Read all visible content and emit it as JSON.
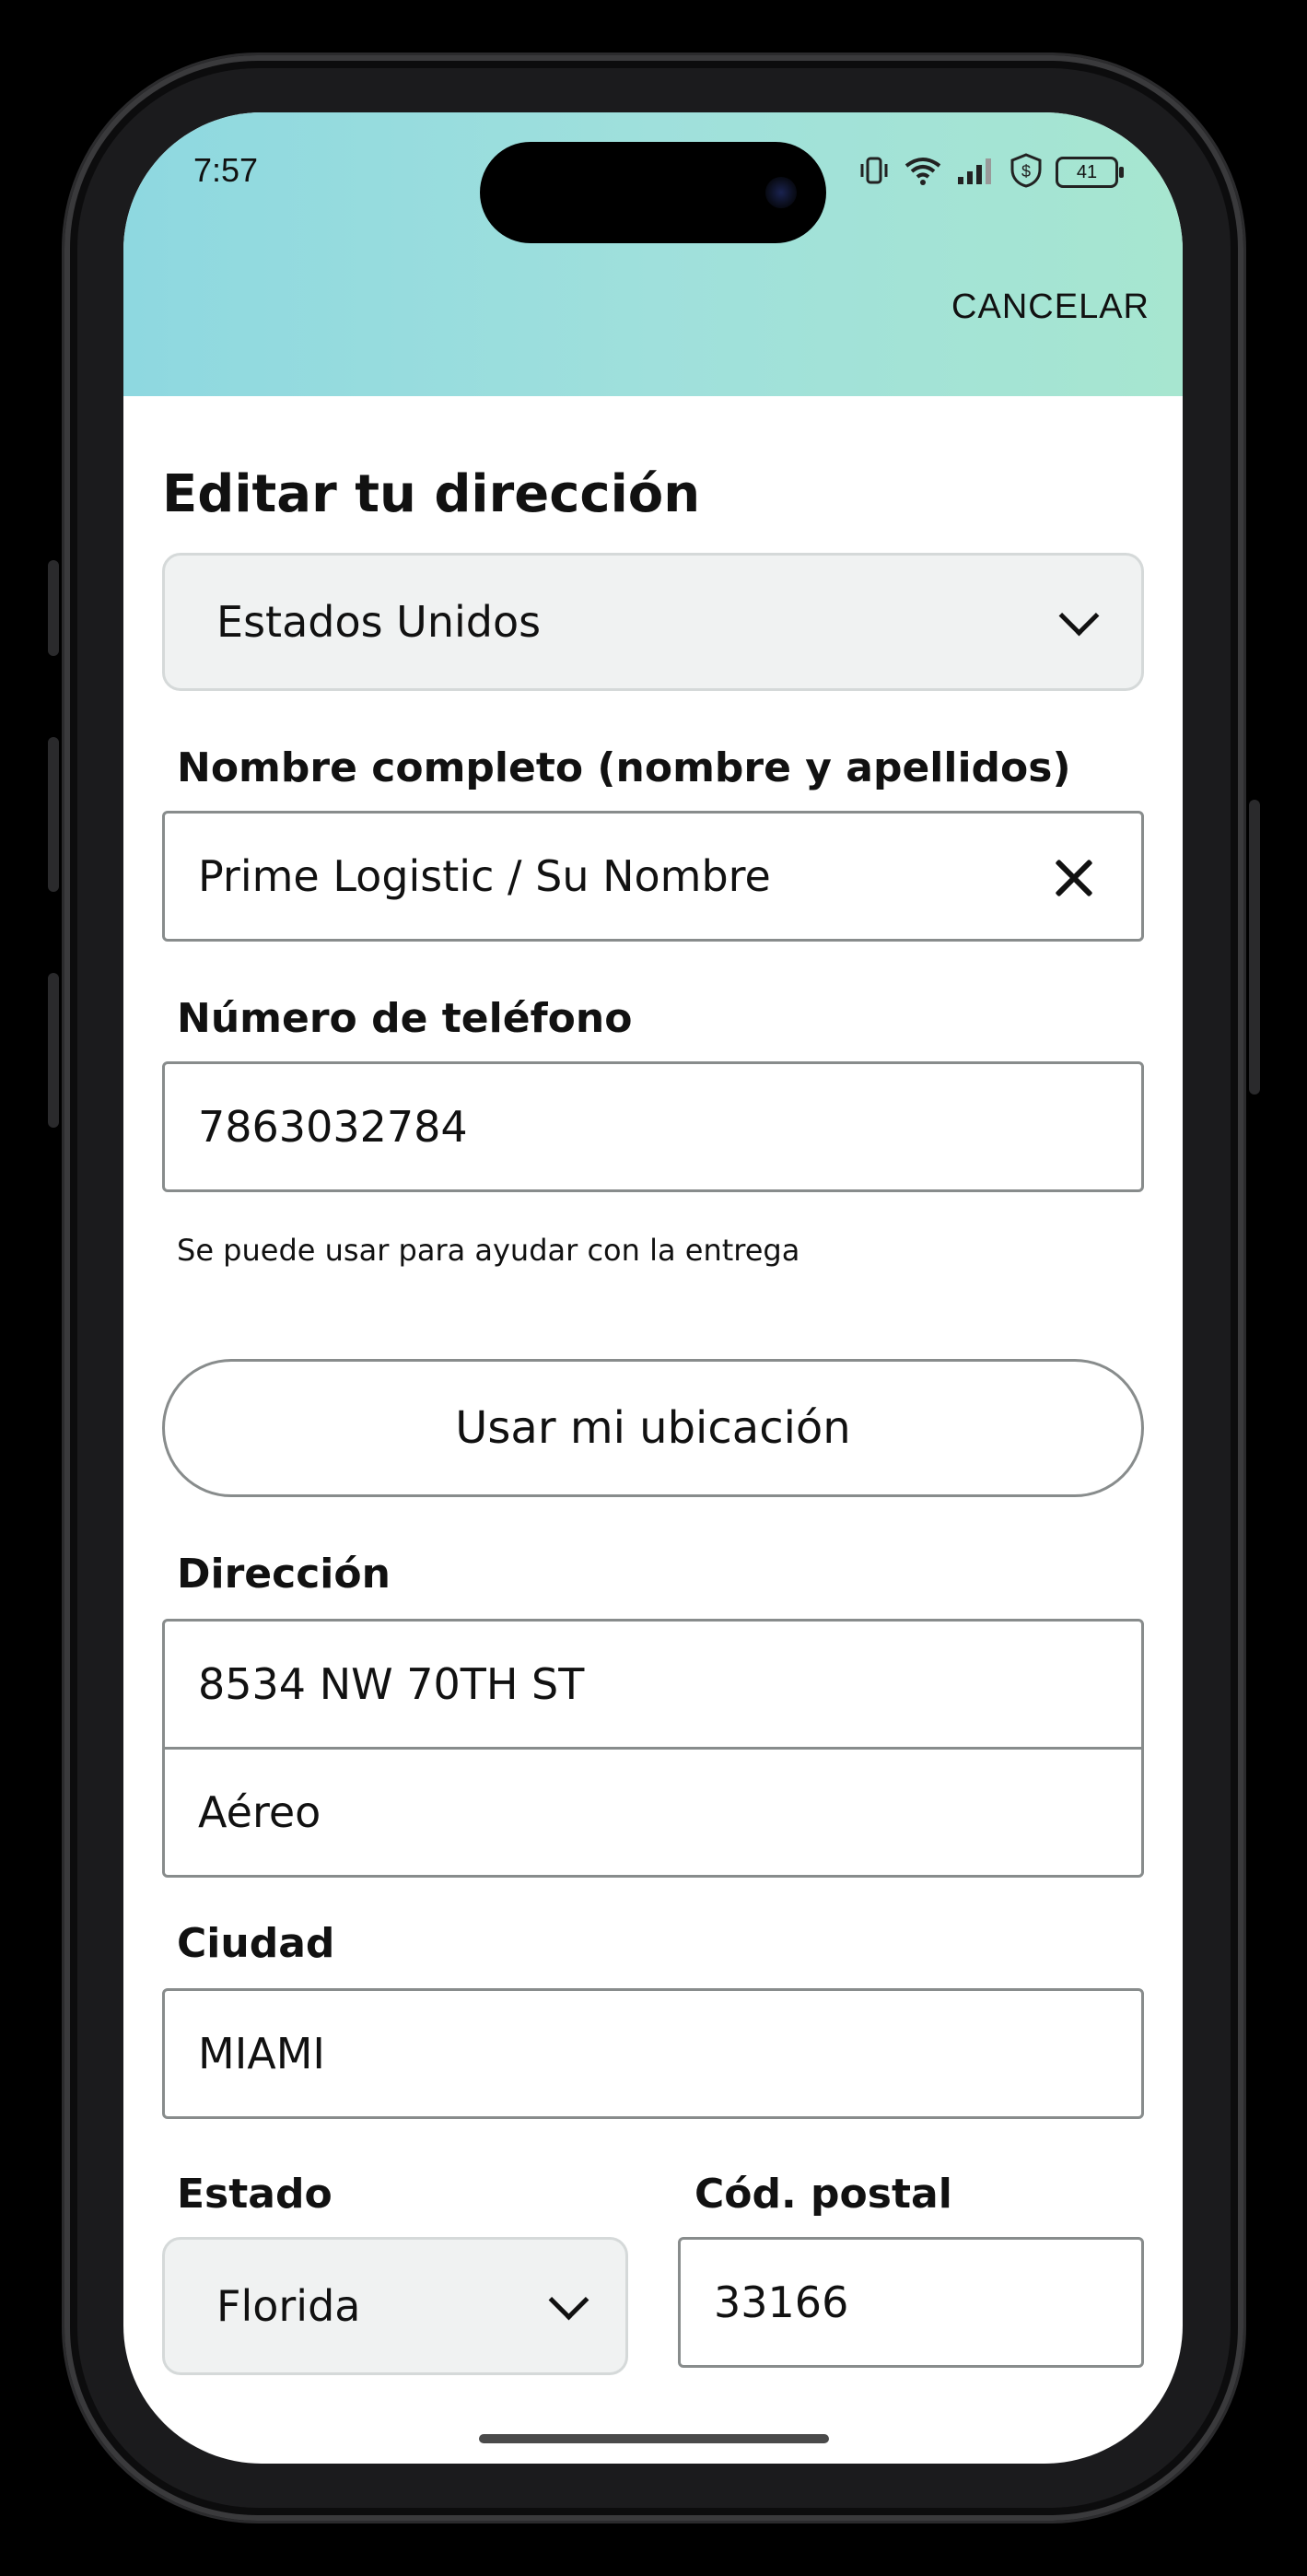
{
  "status_bar": {
    "time": "7:57",
    "battery": "41"
  },
  "header": {
    "cancel_label": "CANCELAR"
  },
  "form": {
    "title": "Editar tu dirección",
    "country": {
      "value": "Estados Unidos"
    },
    "full_name": {
      "label": "Nombre completo (nombre y apellidos)",
      "value": "Prime Logistic / Su Nombre"
    },
    "phone": {
      "label": "Número de teléfono",
      "value": "7863032784",
      "helper": "Se puede usar para ayudar con la entrega"
    },
    "use_location_label": "Usar mi ubicación",
    "address": {
      "label": "Dirección",
      "line1": "8534 NW 70TH ST",
      "line2": "Aéreo"
    },
    "city": {
      "label": "Ciudad",
      "value": "MIAMI"
    },
    "state": {
      "label": "Estado",
      "value": "Florida"
    },
    "postal": {
      "label": "Cód. postal",
      "value": "33166"
    }
  },
  "colors": {
    "header_gradient_start": "#8ed8e0",
    "header_gradient_end": "#a7e6d0",
    "select_bg": "#f0f2f2",
    "field_border": "#888c8c"
  }
}
